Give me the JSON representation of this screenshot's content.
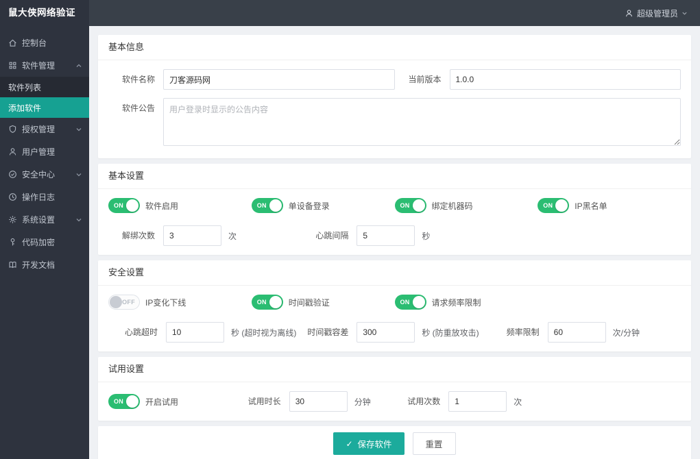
{
  "colors": {
    "sidebar_bg": "#2e333e",
    "submenu_bg": "#262a33",
    "header_bg": "#394049",
    "page_bg": "#eff1f4",
    "accent_teal": "#16a192",
    "save_button_teal": "#1cab9c",
    "toggle_on_green": "#2bbd72"
  },
  "toggle_labels": {
    "on": "ON",
    "off": "OFF"
  },
  "sidebar": {
    "logo": "鼠大侠网络验证",
    "items": [
      {
        "name": "console",
        "label": "控制台",
        "icon": "home-icon",
        "type": "item"
      },
      {
        "name": "software-management",
        "label": "软件管理",
        "icon": "grid-icon",
        "type": "item",
        "chevron": "up"
      },
      {
        "name": "software-list",
        "label": "软件列表",
        "type": "subitem"
      },
      {
        "name": "add-software",
        "label": "添加软件",
        "type": "subitem",
        "active": true
      },
      {
        "name": "auth-management",
        "label": "授权管理",
        "icon": "shield-icon",
        "type": "item",
        "chevron": "down"
      },
      {
        "name": "user-management",
        "label": "用户管理",
        "icon": "user-icon",
        "type": "item"
      },
      {
        "name": "security-center",
        "label": "安全中心",
        "icon": "circle-check-icon",
        "type": "item",
        "chevron": "down"
      },
      {
        "name": "operation-log",
        "label": "操作日志",
        "icon": "clock-icon",
        "type": "item"
      },
      {
        "name": "system-settings",
        "label": "系统设置",
        "icon": "gear-icon",
        "type": "item",
        "chevron": "down"
      },
      {
        "name": "code-encryption",
        "label": "代码加密",
        "icon": "key-icon",
        "type": "item"
      },
      {
        "name": "dev-docs",
        "label": "开发文档",
        "icon": "book-icon",
        "type": "item"
      }
    ]
  },
  "header": {
    "user": "超级管理员",
    "user_icon": "person-icon",
    "chevron_icon": "chevron-down-icon"
  },
  "basic_info": {
    "title": "基本信息",
    "name_label": "软件名称",
    "name_value": "刀客源码网",
    "version_label": "当前版本",
    "version_value": "1.0.0",
    "notice_label": "软件公告",
    "notice_placeholder": "用户登录时显示的公告内容"
  },
  "basic_settings": {
    "title": "基本设置",
    "toggles": [
      {
        "label": "软件启用",
        "state": true
      },
      {
        "label": "单设备登录",
        "state": true
      },
      {
        "label": "绑定机器码",
        "state": true
      },
      {
        "label": "IP黑名单",
        "state": true
      }
    ],
    "unbind_label": "解绑次数",
    "unbind_value": "3",
    "unbind_unit": "次",
    "heartbeat_label": "心跳间隔",
    "heartbeat_value": "5",
    "heartbeat_unit": "秒"
  },
  "security_settings": {
    "title": "安全设置",
    "toggles": [
      {
        "label": "IP变化下线",
        "state": false
      },
      {
        "label": "时间戳验证",
        "state": true
      },
      {
        "label": "请求频率限制",
        "state": true
      }
    ],
    "fields": [
      {
        "label": "心跳超时",
        "value": "10",
        "unit": "秒 (超时视为离线)"
      },
      {
        "label": "时间戳容差",
        "value": "300",
        "unit": "秒 (防重放攻击)"
      },
      {
        "label": "频率限制",
        "value": "60",
        "unit": "次/分钟"
      }
    ]
  },
  "trial_settings": {
    "title": "试用设置",
    "toggle": {
      "label": "开启试用",
      "state": true
    },
    "duration_label": "试用时长",
    "duration_value": "30",
    "duration_unit": "分钟",
    "count_label": "试用次数",
    "count_value": "1",
    "count_unit": "次"
  },
  "actions": {
    "save_check": "✓",
    "save": "保存软件",
    "reset": "重置"
  }
}
